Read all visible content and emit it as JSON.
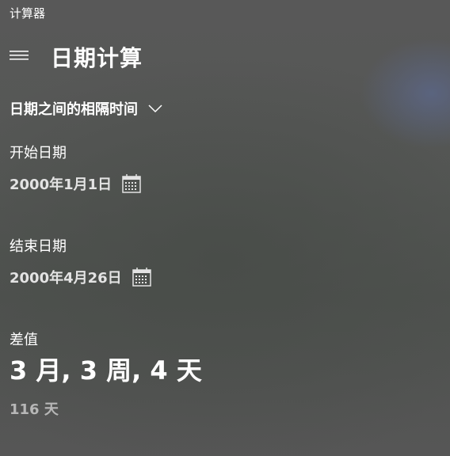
{
  "app": {
    "window_title": "计算器"
  },
  "header": {
    "menu_icon": "hamburger-menu-icon",
    "title": "日期计算"
  },
  "mode": {
    "selected": "日期之间的相隔时间",
    "icon": "chevron-down-icon"
  },
  "start": {
    "label": "开始日期",
    "value": "2000年1月1日",
    "icon": "calendar-icon"
  },
  "end": {
    "label": "结束日期",
    "value": "2000年4月26日",
    "icon": "calendar-icon"
  },
  "result": {
    "label": "差值",
    "difference": "3 月, 3 周, 4 天",
    "total_days": "116 天"
  },
  "colors": {
    "text": "#ffffff",
    "date_text": "#e3e3e3",
    "secondary_text": "#b7b7b7"
  }
}
